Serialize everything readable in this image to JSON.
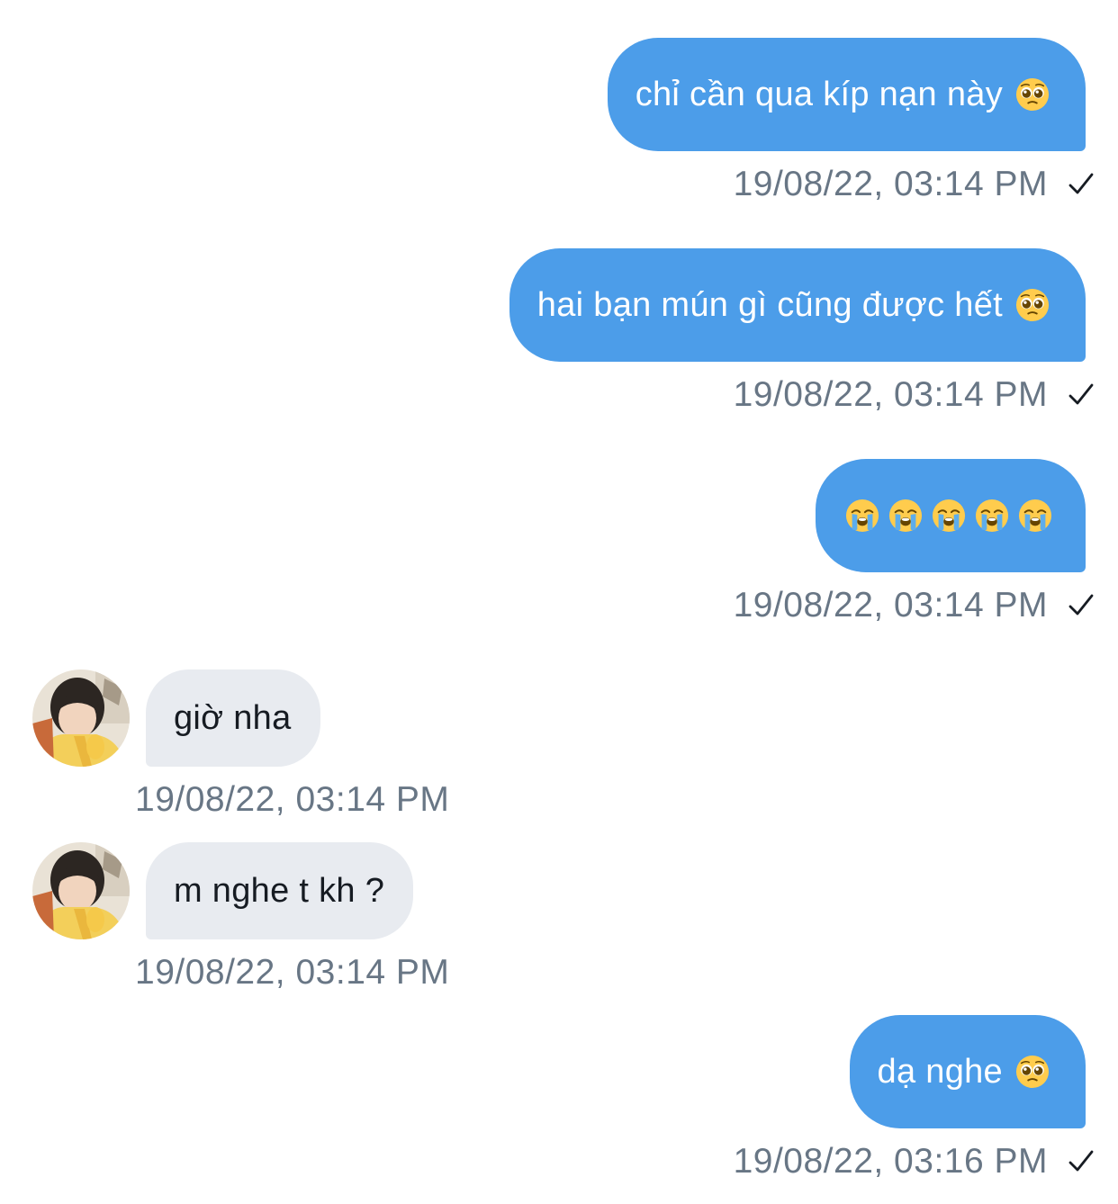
{
  "colors": {
    "outgoing_bubble": "#4c9de9",
    "incoming_bubble": "#e8ebf0",
    "timestamp": "#687685",
    "background": "#ffffff"
  },
  "messages": [
    {
      "direction": "outgoing",
      "text": "chỉ cần qua kíp nạn này",
      "emoji": [
        "pleading-face-icon"
      ],
      "timestamp": "19/08/22, 03:14 PM",
      "status": "sent-check-icon"
    },
    {
      "direction": "outgoing",
      "text": "hai bạn mún gì cũng được hết",
      "emoji": [
        "pleading-face-icon"
      ],
      "timestamp": "19/08/22, 03:14 PM",
      "status": "sent-check-icon"
    },
    {
      "direction": "outgoing",
      "text": "",
      "emoji": [
        "loudly-crying-face-icon",
        "loudly-crying-face-icon",
        "loudly-crying-face-icon",
        "loudly-crying-face-icon",
        "loudly-crying-face-icon"
      ],
      "timestamp": "19/08/22, 03:14 PM",
      "status": "sent-check-icon"
    },
    {
      "direction": "incoming",
      "text": "giờ nha",
      "avatar": "avatar-icon",
      "timestamp": "19/08/22, 03:14 PM"
    },
    {
      "direction": "incoming",
      "text": "m nghe t kh ?",
      "avatar": "avatar-icon",
      "timestamp": "19/08/22, 03:14 PM"
    },
    {
      "direction": "outgoing",
      "text": "dạ nghe",
      "emoji": [
        "pleading-face-icon"
      ],
      "timestamp": "19/08/22, 03:16 PM",
      "status": "sent-check-icon"
    }
  ]
}
